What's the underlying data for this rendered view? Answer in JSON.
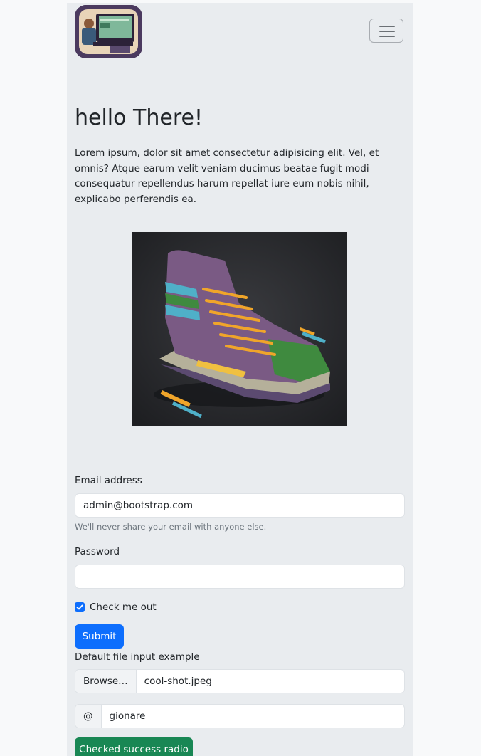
{
  "navbar": {
    "logo_alt": "logo",
    "toggle_label": "Toggle navigation"
  },
  "hero": {
    "title": "hello There!",
    "text": "Lorem ipsum, dolor sit amet consectetur adipisicing elit. Vel, et omnis? Atque earum velit veniam ducimus beatae fugit modi consequatur repellendus harum repellat iure eum nobis nihil, explicabo perferendis ea.",
    "image": "sneaker-illustration"
  },
  "form": {
    "email_label": "Email address",
    "email_value": "admin@bootstrap.com",
    "email_help": "We'll never share your email with anyone else.",
    "password_label": "Password",
    "password_value": "",
    "checkbox_label": "Check me out",
    "checkbox_checked": true,
    "submit_label": "Submit",
    "file_label": "Default file input example",
    "file_button": "Browse…",
    "file_value": "cool-shot.jpeg",
    "username_prefix": "@",
    "username_value": "gionare",
    "radio_button_label": "Checked success radio"
  },
  "colors": {
    "primary": "#0d6efd",
    "success": "#198754",
    "container_bg": "#e9ecef"
  }
}
